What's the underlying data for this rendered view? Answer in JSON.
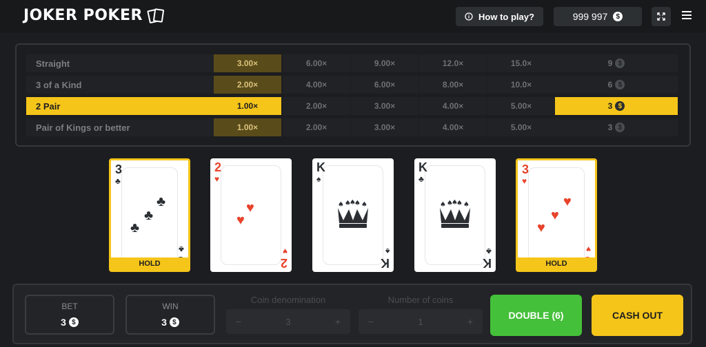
{
  "header": {
    "logo_text": "JOKER POKER",
    "how_to_play": "How to play?",
    "balance": "999 997",
    "coin_symbol": "$"
  },
  "paytable": {
    "rows": [
      {
        "name": "Straight",
        "values": [
          "3.00×",
          "6.00×",
          "9.00×",
          "12.0×",
          "15.0×"
        ],
        "win": "9",
        "active": false
      },
      {
        "name": "3 of a Kind",
        "values": [
          "2.00×",
          "4.00×",
          "6.00×",
          "8.00×",
          "10.0×"
        ],
        "win": "6",
        "active": false
      },
      {
        "name": "2 Pair",
        "values": [
          "1.00×",
          "2.00×",
          "3.00×",
          "4.00×",
          "5.00×"
        ],
        "win": "3",
        "active": true
      },
      {
        "name": "Pair of Kings or better",
        "values": [
          "1.00×",
          "2.00×",
          "3.00×",
          "4.00×",
          "5.00×"
        ],
        "win": "3",
        "active": false
      }
    ]
  },
  "cards": [
    {
      "rank": "3",
      "suit": "♣",
      "color": "black",
      "held": true,
      "hold_label": "HOLD"
    },
    {
      "rank": "2",
      "suit": "♥",
      "color": "red",
      "held": false,
      "hold_label": ""
    },
    {
      "rank": "K",
      "suit": "♠",
      "color": "black",
      "held": false,
      "hold_label": ""
    },
    {
      "rank": "K",
      "suit": "♣",
      "color": "black",
      "held": false,
      "hold_label": ""
    },
    {
      "rank": "3",
      "suit": "♥",
      "color": "red",
      "held": true,
      "hold_label": "HOLD"
    }
  ],
  "controls": {
    "bet_label": "BET",
    "bet_value": "3",
    "win_label": "WIN",
    "win_value": "3",
    "coin_denom_label": "Coin denomination",
    "coin_denom_value": "3",
    "num_coins_label": "Number of coins",
    "num_coins_value": "1",
    "minus": "−",
    "plus": "+",
    "double_label": "DOUBLE (6)",
    "cashout_label": "CASH OUT"
  },
  "colors": {
    "accent": "#f5c51a",
    "double": "#45c03a",
    "background": "#1c1d20",
    "red_suit": "#e8432b"
  }
}
